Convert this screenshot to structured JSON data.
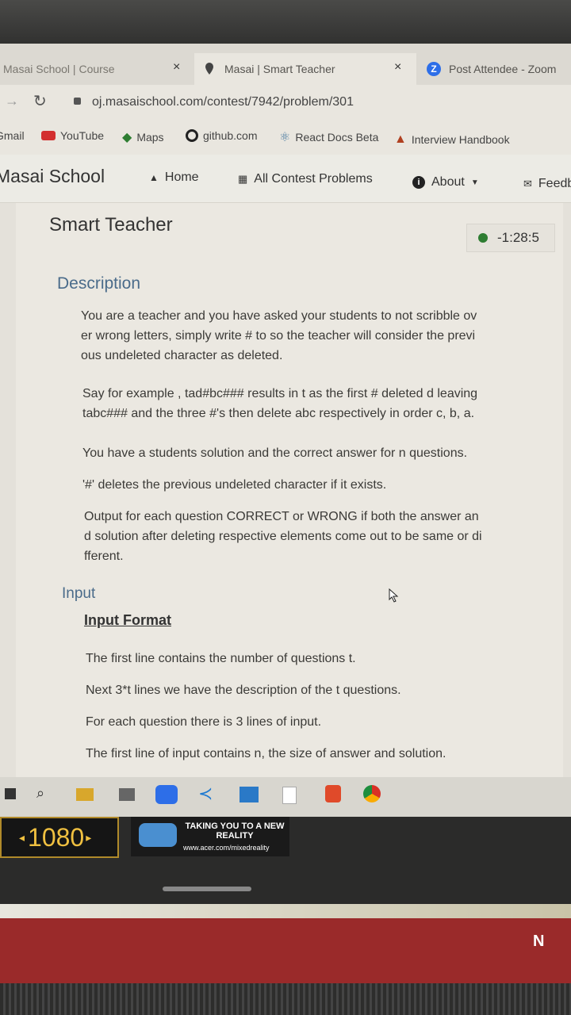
{
  "tabs": [
    {
      "label": "Masai School | Course",
      "close": "×"
    },
    {
      "label": "Masai | Smart Teacher",
      "close": "×"
    },
    {
      "label": "Post Attendee - Zoom"
    }
  ],
  "address": {
    "url": "oj.masaischool.com/contest/7942/problem/301"
  },
  "bookmarks": [
    "Gmail",
    "YouTube",
    "Maps",
    "github.com",
    "React Docs Beta",
    "Interview Handbook"
  ],
  "site": {
    "brand": "Masai School",
    "nav": {
      "home": "Home",
      "contests": "All Contest Problems",
      "about": "About",
      "feedback": "Feedback"
    }
  },
  "problem": {
    "title": "Smart Teacher",
    "timer": "-1:28:5",
    "description_heading": "Description",
    "description": [
      "You are a teacher and you have asked your students to not scribble ov",
      "er wrong letters, simply write # to so the teacher will consider the previ",
      "ous undeleted character as deleted.",
      "Say for example , tad#bc### results in t as the first # deleted d leaving",
      "tabc### and the three #'s then delete abc respectively in order c, b, a.",
      "You have a students solution and the correct answer for n questions.",
      "'#' deletes the previous undeleted character if it exists.",
      "Output for each question CORRECT or WRONG if both the answer an",
      "d solution after deleting respective elements come out to be same or di",
      "fferent."
    ],
    "input_heading": "Input",
    "input_format_heading": "Input Format",
    "input_format": [
      "The first line contains the number of questions t.",
      "Next 3*t lines we have the description of the t questions.",
      "For each question there is 3 lines of input.",
      "The first line of input contains n, the size of answer and solution."
    ]
  },
  "laptop": {
    "sticker_resolution": "1080",
    "sticker_tagline": "TAKING YOU TO A NEW REALITY",
    "sticker_url": "www.acer.com/mixedreality",
    "keyboard_letter": "N"
  }
}
